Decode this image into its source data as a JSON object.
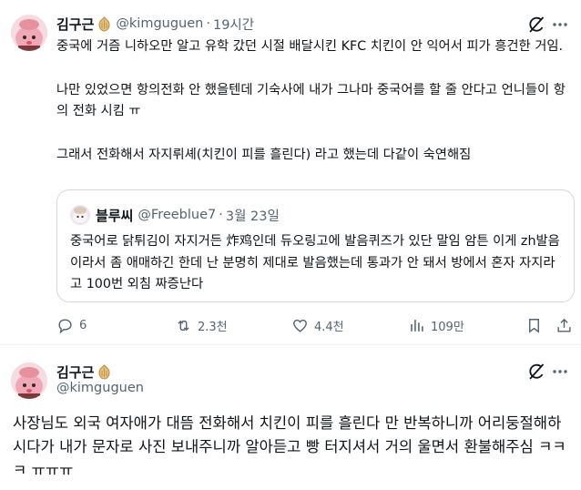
{
  "tweet1": {
    "author_name": "김구근",
    "author_handle": "@kimguguen",
    "separator": "·",
    "time": "19시간",
    "paragraphs": [
      "중국에 거즘 니하오만 알고 유학 갔던 시절 배달시킨 KFC 치킨이 안 익어서 피가 흥건한 거임.",
      "나만 있었으면 항의전화 안 했을텐데 기숙사에 내가 그나마 중국어를 할 줄 안다고 언니들이 항의 전화 시킴 ㅠ",
      "그래서 전화해서 자지뤼셰(치킨이 피를 흘린다) 라고 했는데 다같이 숙연해짐"
    ],
    "quote": {
      "author_name": "블루씨",
      "author_handle": "@Freeblue7",
      "separator": "·",
      "date": "3월 23일",
      "text": "중국어로 닭튀김이 자지거든 炸鸡인데 듀오링고에 발음퀴즈가 있단 말임 암튼 이게 zh발음이라서 좀 애매하긴 한데 난 분명히 제대로 발음했는데 통과가 안 돼서 방에서 혼자 자지라고 100번 외침 짜증난다"
    },
    "actions": {
      "replies": "6",
      "retweets": "2.3천",
      "likes": "4.4천",
      "views": "109만"
    }
  },
  "tweet2": {
    "author_name": "김구근",
    "author_handle": "@kimguguen",
    "text": "사장님도 외국 여자애가 대뜸 전화해서 치킨이 피를 흘린다 만 반복하니까 어리둥절해하시다가 내가 문자로 사진 보내주니까 알아듣고 빵 터지셔서 거의 울면서 환불해주심 ㅋㅋㅋ ㅠㅠㅠ"
  },
  "icons": {
    "grok": "grok-icon",
    "more": "more-icon",
    "reply": "reply-icon",
    "retweet": "retweet-icon",
    "like": "heart-icon",
    "views": "views-icon",
    "badge": "badge-icon"
  },
  "colors": {
    "text": "#0f1419",
    "muted": "#536471",
    "border": "#cfd9de",
    "badge": "#c99a4a"
  }
}
